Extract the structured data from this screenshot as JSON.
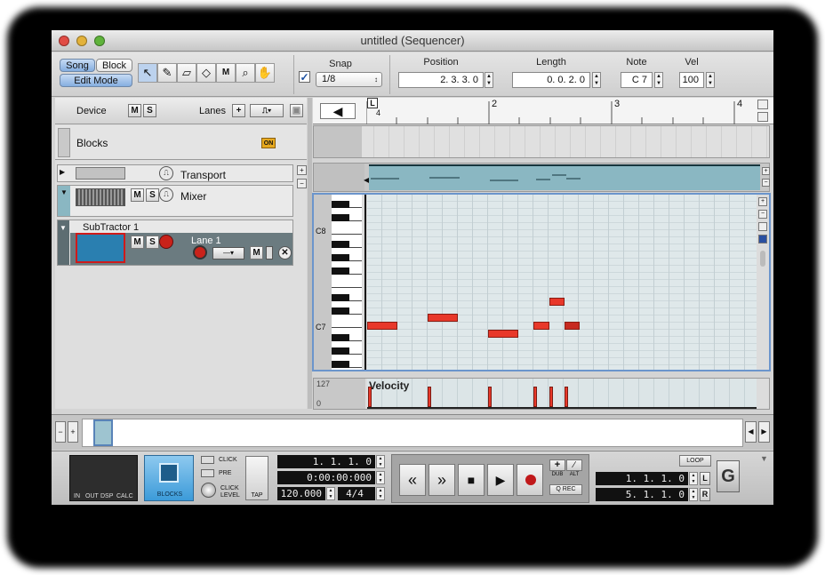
{
  "window": {
    "title": "untitled (Sequencer)"
  },
  "toolbar": {
    "song_label": "Song",
    "block_label": "Block",
    "edit_mode_label": "Edit Mode",
    "snap_label": "Snap",
    "snap_value": "1/8",
    "position_label": "Position",
    "position_value": "2.  3.  3.    0",
    "length_label": "Length",
    "length_value": "0.  0.  2.    0",
    "note_label": "Note",
    "note_value": "C 7",
    "vel_label": "Vel",
    "vel_value": "100"
  },
  "track_header": {
    "device_label": "Device",
    "lanes_label": "Lanes",
    "m": "M",
    "s": "S"
  },
  "blocks": {
    "label": "Blocks",
    "on_badge": "ON"
  },
  "tracks": [
    {
      "name": "Transport"
    },
    {
      "name": "Mixer"
    },
    {
      "name": "SubTractor 1",
      "lane": "Lane 1"
    }
  ],
  "ruler": {
    "marks": [
      "4",
      "2",
      "3",
      "4"
    ],
    "loop_marker": "L"
  },
  "piano": {
    "labels": [
      "C8",
      "C7"
    ]
  },
  "velocity": {
    "label": "Velocity",
    "max": "127",
    "min": "0"
  },
  "transport": {
    "meter_labels": [
      "IN",
      "OUT",
      "DSP",
      "CALC"
    ],
    "blocks_label": "BLOCKS",
    "click_label": "CLICK",
    "pre_label": "PRE",
    "click_level_label": "CLICK LEVEL",
    "tap_label": "TAP",
    "bar_position": "1.  1.  1.    0",
    "time_position": "0:00:00:000",
    "tempo": "120.000",
    "signature": "4/4",
    "dub_label": "DUB",
    "alt_label": "ALT",
    "qrec_label": "Q REC",
    "loop_label": "LOOP",
    "left_locator": "1.  1.  1.    0",
    "right_locator": "5.  1.  1.    0",
    "l_label": "L",
    "r_label": "R"
  },
  "colors": {
    "note": "#e8382a",
    "selection_blue": "#86aee0",
    "lane_teal": "#8ab7c2"
  }
}
